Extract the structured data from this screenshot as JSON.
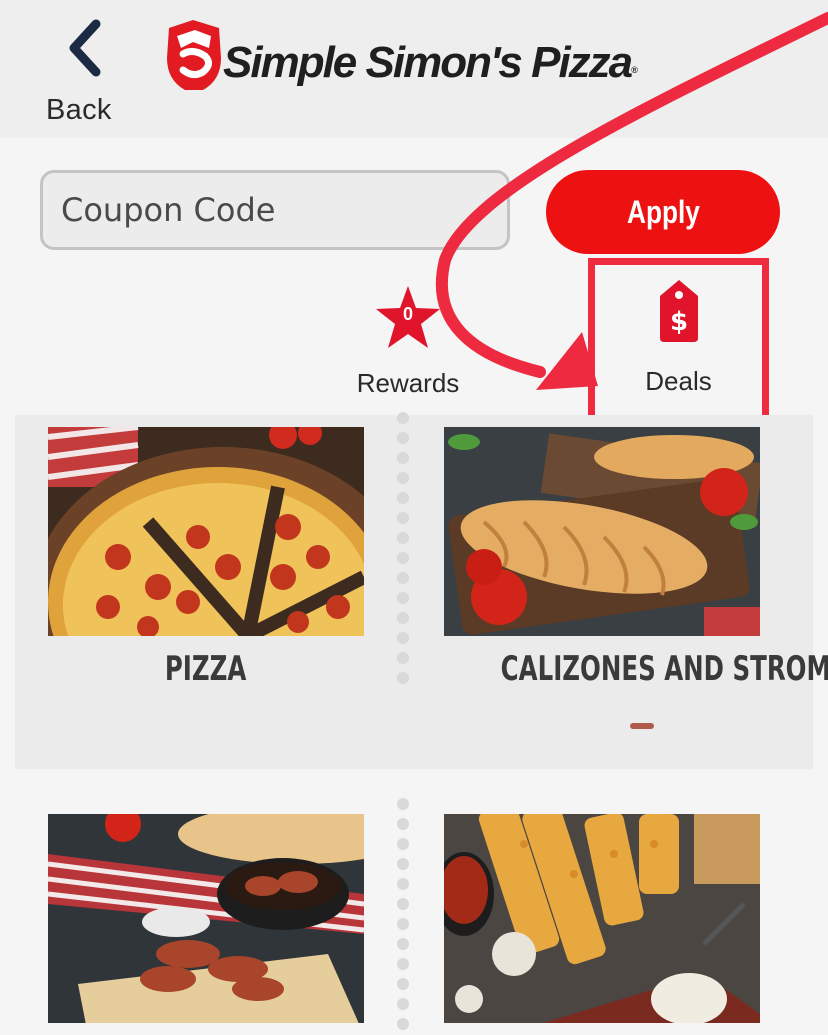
{
  "header": {
    "back_label": "Back",
    "brand_name": "Simple Simon's Pizza",
    "brand_mark": "®"
  },
  "coupon": {
    "placeholder": "Coupon Code",
    "apply_label": "Apply"
  },
  "rewards": {
    "count": "0",
    "label": "Rewards",
    "icon": "star-icon"
  },
  "deals": {
    "label": "Deals",
    "icon": "price-tag-dollar-icon"
  },
  "categories": [
    {
      "title": "PIZZA"
    },
    {
      "title": "CALIZONES AND STROMBOLI"
    },
    {
      "title": ""
    },
    {
      "title": ""
    }
  ],
  "colors": {
    "accent": "#ee1111",
    "highlight": "#ef2b40",
    "annotation_arrow": "#ee2a40"
  }
}
